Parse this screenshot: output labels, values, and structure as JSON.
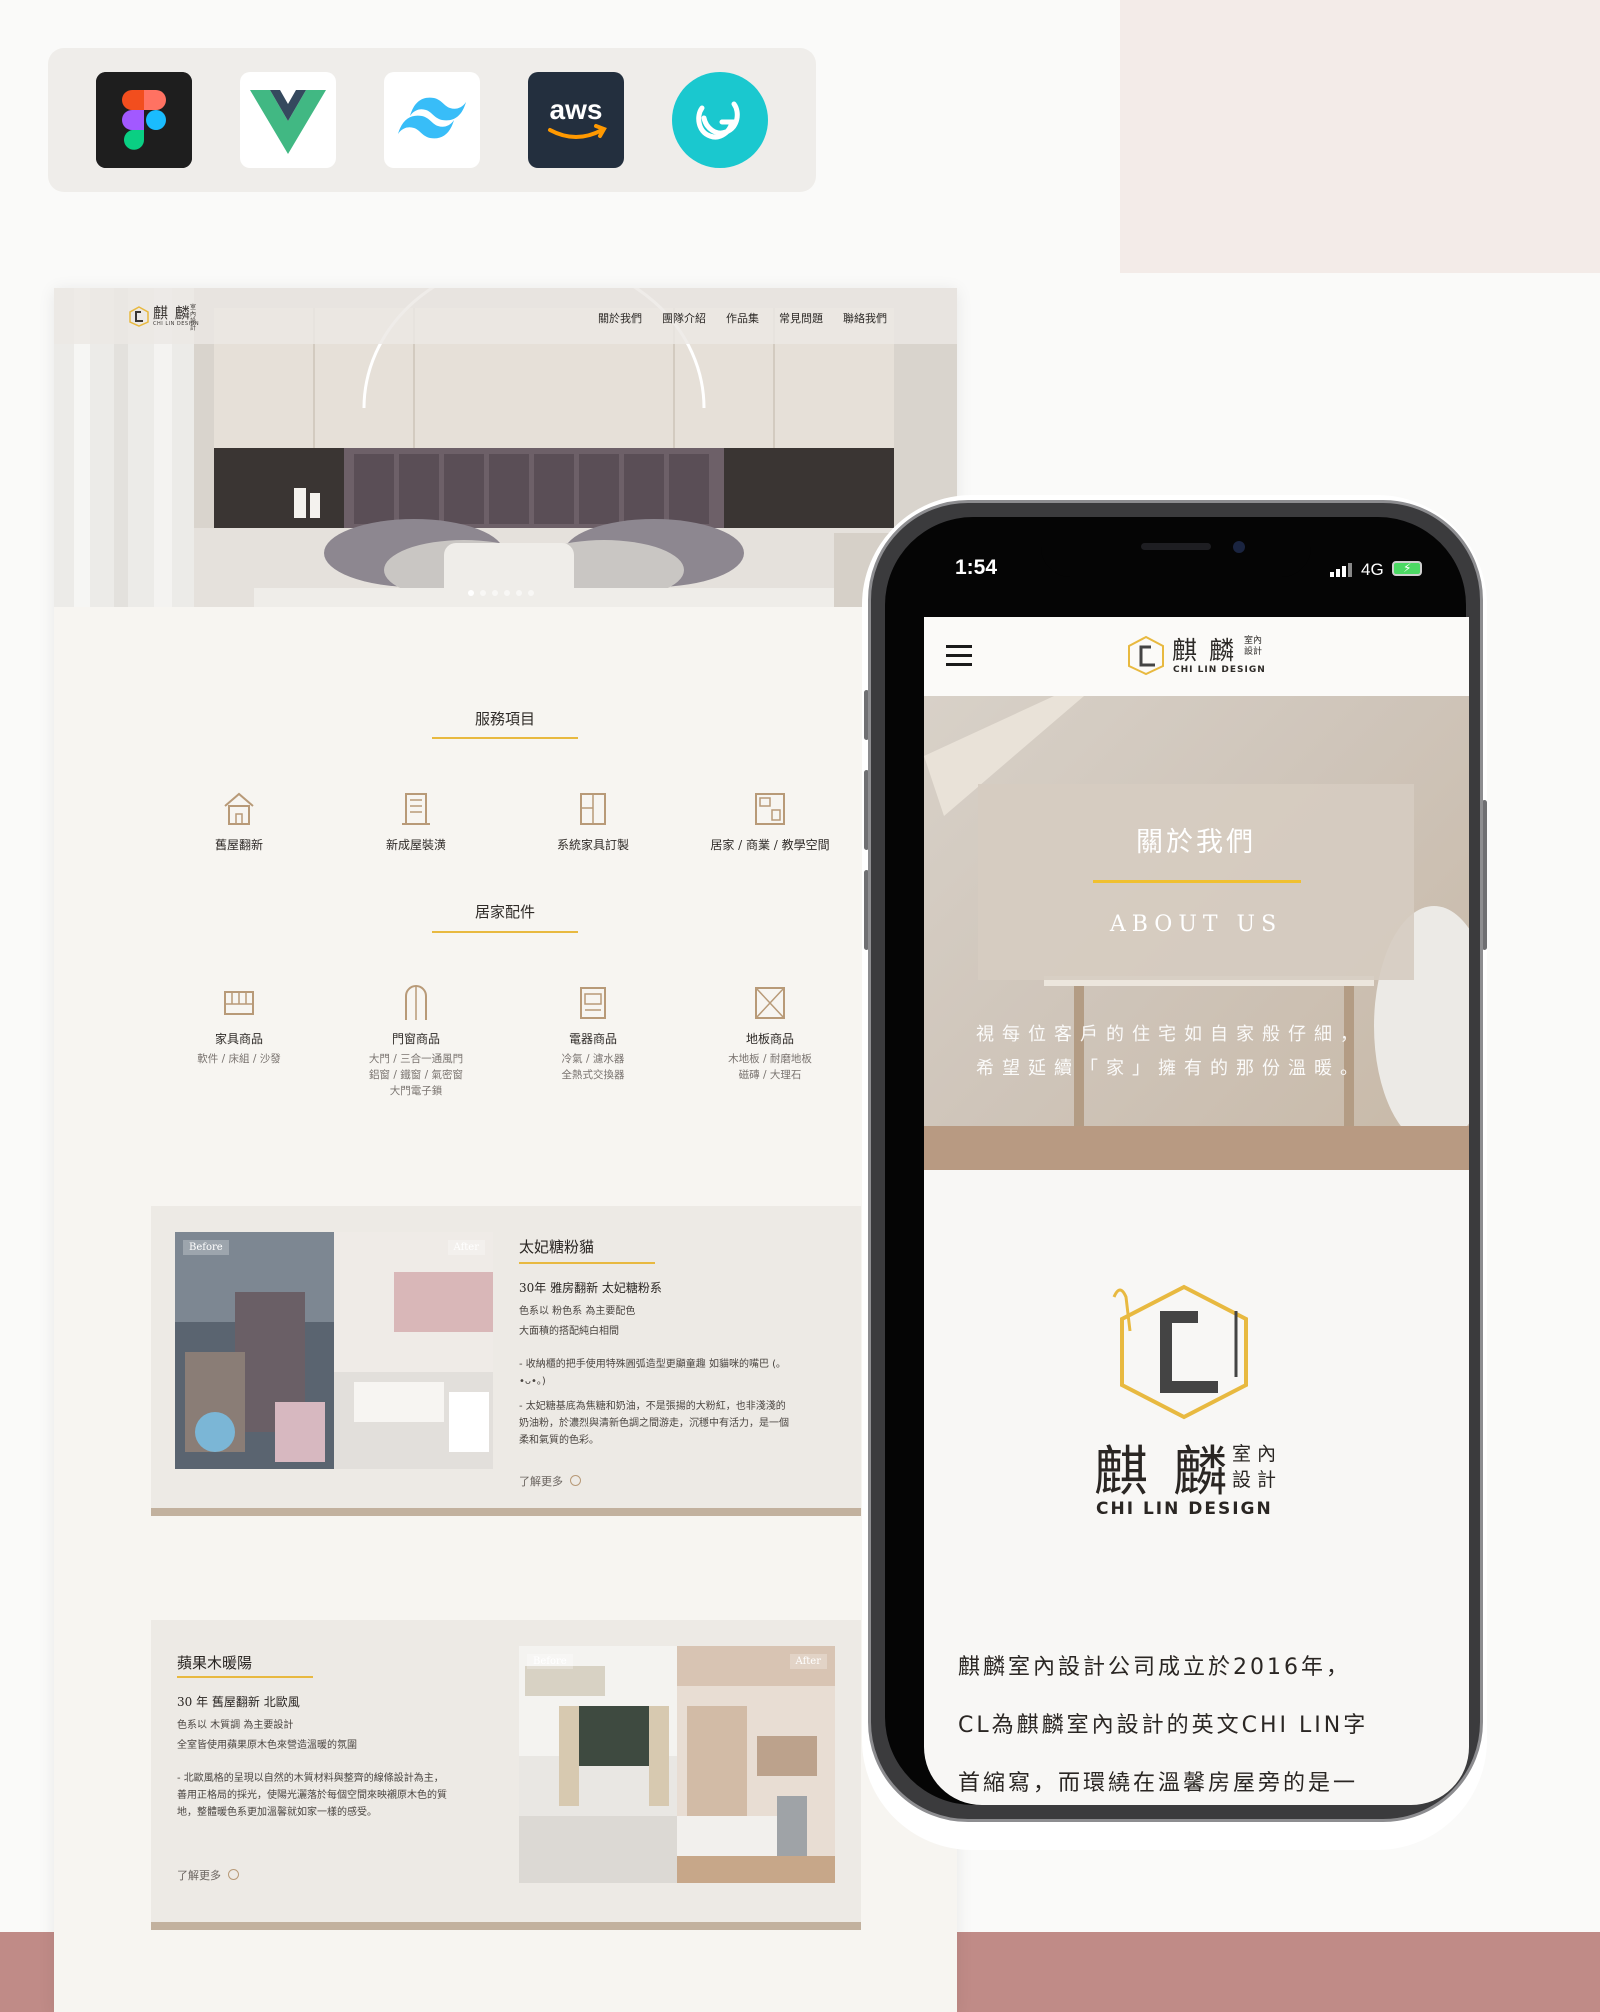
{
  "colors": {
    "accent": "#e8b940",
    "rose": "#c08b87",
    "blush": "#f3ebe8",
    "aws": "#232f3e",
    "teal": "#1ac8cf"
  },
  "tools": [
    "figma-icon",
    "vue-icon",
    "tailwind-icon",
    "aws-icon",
    "godaddy-icon"
  ],
  "aws_label": "aws",
  "desktop": {
    "logo": {
      "zh": "麒 麟",
      "zh_small": "室內設計",
      "en": "CHI LIN DESIGN"
    },
    "nav": [
      "關於我們",
      "團隊介紹",
      "作品集",
      "常見問題",
      "聯絡我們"
    ],
    "services_title": "服務項目",
    "services": [
      {
        "label": "舊屋翻新",
        "icon": "house-icon"
      },
      {
        "label": "新成屋裝潢",
        "icon": "building-icon"
      },
      {
        "label": "系統家具訂製",
        "icon": "cabinet-icon"
      },
      {
        "label": "居家 / 商業 / 教學空間",
        "icon": "space-icon"
      }
    ],
    "products_title": "居家配件",
    "products": [
      {
        "label": "家具商品",
        "desc": [
          "軟件 / 床組 / 沙發"
        ],
        "icon": "sofa-icon"
      },
      {
        "label": "門窗商品",
        "desc": [
          "大門 / 三合一通風門",
          "鋁窗 / 鐵窗 / 氣密窗",
          "大門電子鎖"
        ],
        "icon": "door-icon"
      },
      {
        "label": "電器商品",
        "desc": [
          "冷氣 / 濾水器",
          "全熱式交換器"
        ],
        "icon": "appliance-icon"
      },
      {
        "label": "地板商品",
        "desc": [
          "木地板 / 耐磨地板",
          "磁磚 / 大理石"
        ],
        "icon": "floor-icon"
      }
    ],
    "case1": {
      "before": "Before",
      "after": "After",
      "title": "太妃糖粉貓",
      "subtitle": "30年 雅房翻新 太妃糖粉系",
      "p1": "色系以 粉色系 為主要配色",
      "p2": "大面積的搭配純白相間",
      "b1": "- 收納櫃的把手使用特殊圓弧造型更顯童趣 如貓咪的嘴巴 (｡•ᴗ•｡)",
      "b2": "- 太妃糖基底為焦糖和奶油，不是張揚的大粉紅，也非淺淺的奶油粉，於濃烈與清新色調之間游走，沉穩中有活力，是一個柔和氣質的色彩。",
      "more": "了解更多"
    },
    "case2": {
      "before": "Before",
      "after": "After",
      "title": "蘋果木暖陽",
      "subtitle": "30 年 舊屋翻新 北歐風",
      "p1": "色系以 木質調 為主要設計",
      "p2": "全室皆使用蘋果原木色來營造溫暖的氛圍",
      "b1": "- 北歐風格的呈現以自然的木質材料與整齊的線條設計為主，善用正格局的採光，使陽光灑落於每個空間來映襯原木色的質地，整體暖色系更加溫馨就如家一樣的感受。",
      "more": "了解更多"
    }
  },
  "mobile": {
    "status_time": "1:54",
    "status_net": "4G",
    "logo": {
      "zh": "麒 麟",
      "zh_small": "室內設計",
      "en": "CHI LIN DESIGN"
    },
    "hero_title": "關於我們",
    "hero_subtitle": "ABOUT US",
    "quote_1": "視每位客戶的住宅如自家般仔細，",
    "quote_2": "希望延續「家」擁有的那份溫暖。",
    "big_logo": {
      "zh": "麒 麟",
      "zh_small_1": "室 內",
      "zh_small_2": "設 計",
      "en": "CHI LIN DESIGN"
    },
    "text_1": "麒麟室內設計公司成立於2016年，",
    "text_2": "CL為麒麟室內設計的英文CHI LIN字",
    "text_3": "首縮寫，而環繞在溫馨房屋旁的是一"
  }
}
